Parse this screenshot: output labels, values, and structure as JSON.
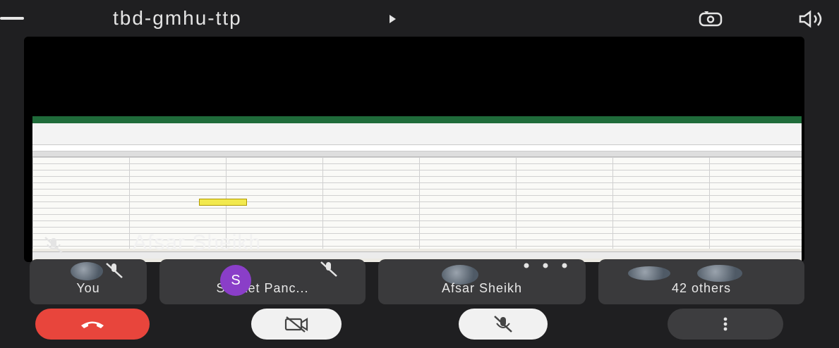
{
  "header": {
    "meeting_code": "tbd-gmhu-ttp",
    "icons": [
      "back-dash-icon",
      "play-arrow-icon",
      "camera-switch-icon",
      "speaker-icon"
    ]
  },
  "main_stage": {
    "presenter_name": "Afsar Sheikh",
    "presenter_mic": "muted",
    "content": "shared-screen-spreadsheet"
  },
  "participants": [
    {
      "label": "You",
      "avatar": "photo",
      "mic": "muted"
    },
    {
      "label": "Sanket Panc...",
      "avatar_letter": "S",
      "avatar_color": "#8a3ec8",
      "mic": "muted"
    },
    {
      "label": "Afsar Sheikh",
      "avatar": "photo",
      "has_more_menu": true
    },
    {
      "label": "42 others",
      "avatar": "photo-stack"
    }
  ],
  "controls": [
    {
      "name": "end-call",
      "icon": "phone-hangup-icon",
      "color": "#e8453c"
    },
    {
      "name": "camera-toggle",
      "icon": "camera-off-icon",
      "state": "off"
    },
    {
      "name": "mic-toggle",
      "icon": "mic-off-icon",
      "state": "muted"
    },
    {
      "name": "more-options",
      "icon": "more-vert-icon"
    }
  ],
  "colors": {
    "background": "#1f1f21",
    "tile": "#3a3a3c",
    "end_call": "#e8453c",
    "excel_green": "#1f6b3a"
  }
}
